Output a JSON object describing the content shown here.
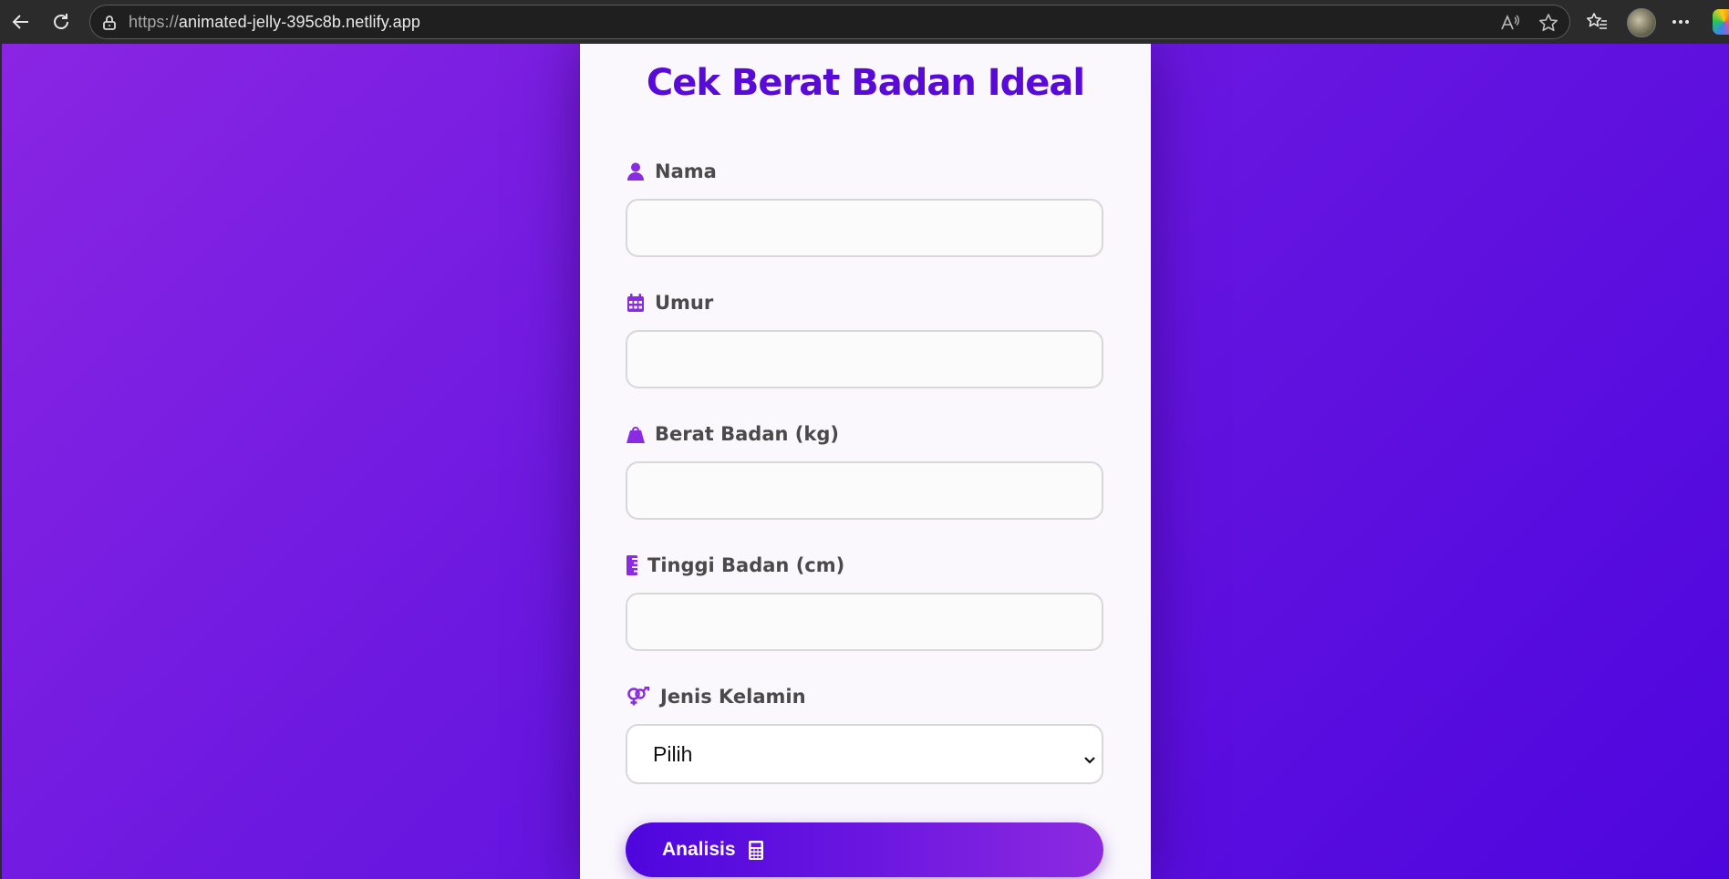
{
  "browser": {
    "url_protocol": "https://",
    "url_host": "animated-jelly-395c8b.netlify.app"
  },
  "form": {
    "title": "Cek Berat Badan Ideal",
    "fields": [
      {
        "label": "Nama",
        "icon": "user-icon",
        "value": ""
      },
      {
        "label": "Umur",
        "icon": "calendar-icon",
        "value": ""
      },
      {
        "label": "Berat Badan (kg)",
        "icon": "weight-icon",
        "value": ""
      },
      {
        "label": "Tinggi Badan (cm)",
        "icon": "ruler-icon",
        "value": ""
      }
    ],
    "gender": {
      "label": "Jenis Kelamin",
      "icon": "gender-icon",
      "selected": "Pilih"
    },
    "submit": {
      "label": "Analisis",
      "icon": "calculator-icon"
    }
  },
  "colors": {
    "accent": "#5a0ad6",
    "icon": "#8a2be2",
    "background_start": "#8a25e3",
    "background_end": "#4e06de"
  }
}
